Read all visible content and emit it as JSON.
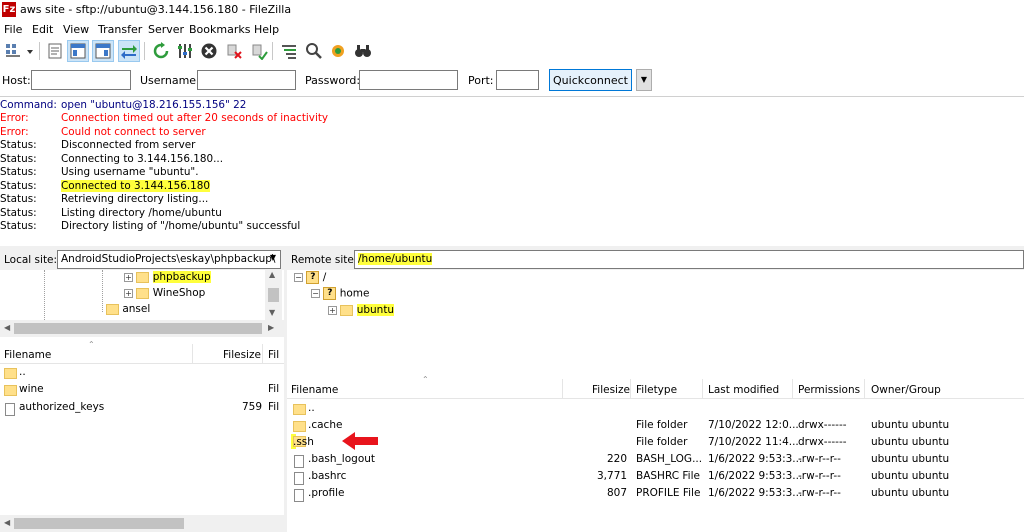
{
  "window": {
    "title": "aws site - sftp://ubuntu@3.144.156.180 - FileZilla",
    "app_icon": "Fz"
  },
  "menu": [
    "File",
    "Edit",
    "View",
    "Transfer",
    "Server",
    "Bookmarks",
    "Help"
  ],
  "toolbar": {
    "icons": [
      "site-manager-icon",
      "dropdown-arrow-icon",
      "message-log-toggle-icon",
      "local-tree-toggle-icon",
      "remote-tree-toggle-icon",
      "transfer-queue-toggle-icon",
      "refresh-icon",
      "process-queue-icon",
      "cancel-icon",
      "disconnect-icon",
      "reconnect-icon",
      "filter-icon",
      "sync-browse-icon",
      "directory-compare-icon",
      "search-icon"
    ]
  },
  "quickconnect": {
    "host_label": "Host:",
    "host_value": "",
    "username_label": "Username:",
    "username_value": "",
    "password_label": "Password:",
    "password_value": "",
    "port_label": "Port:",
    "port_value": "",
    "button_label": "Quickconnect"
  },
  "log": [
    {
      "type": "Command:",
      "msg": "open \"ubuntu@18.216.155.156\" 22",
      "kind": "command"
    },
    {
      "type": "Error:",
      "msg": "Connection timed out after 20 seconds of inactivity",
      "kind": "error"
    },
    {
      "type": "Error:",
      "msg": "Could not connect to server",
      "kind": "error"
    },
    {
      "type": "Status:",
      "msg": "Disconnected from server",
      "kind": "status"
    },
    {
      "type": "Status:",
      "msg": "Connecting to 3.144.156.180...",
      "kind": "status"
    },
    {
      "type": "Status:",
      "msg": "Using username \"ubuntu\".",
      "kind": "status"
    },
    {
      "type": "Status:",
      "msg": "Connected to 3.144.156.180",
      "kind": "status",
      "highlight": true
    },
    {
      "type": "Status:",
      "msg": "Retrieving directory listing...",
      "kind": "status"
    },
    {
      "type": "Status:",
      "msg": "Listing directory /home/ubuntu",
      "kind": "status"
    },
    {
      "type": "Status:",
      "msg": "Directory listing of \"/home/ubuntu\" successful",
      "kind": "status"
    }
  ],
  "local": {
    "site_label": "Local site:",
    "site_path": "AndroidStudioProjects\\eskay\\phpbackup\\",
    "tree": [
      {
        "name": "phpbackup",
        "highlight": true
      },
      {
        "name": "WineShop"
      },
      {
        "name": "ansel"
      }
    ],
    "columns": [
      "Filename",
      "Filesize",
      "Fil"
    ],
    "files": [
      {
        "name": "..",
        "size": "",
        "type": "",
        "icon": "folder"
      },
      {
        "name": "wine",
        "size": "",
        "type": "Fil",
        "icon": "folder"
      },
      {
        "name": "authorized_keys",
        "size": "759",
        "type": "Fil",
        "icon": "file"
      }
    ]
  },
  "remote": {
    "site_label": "Remote site:",
    "site_path": "/home/ubuntu",
    "tree": [
      {
        "name": "/"
      },
      {
        "name": "home"
      },
      {
        "name": "ubuntu",
        "highlight": true
      }
    ],
    "columns": [
      "Filename",
      "Filesize",
      "Filetype",
      "Last modified",
      "Permissions",
      "Owner/Group"
    ],
    "files": [
      {
        "name": "..",
        "size": "",
        "type": "",
        "modified": "",
        "perms": "",
        "owner": "",
        "icon": "folder"
      },
      {
        "name": ".cache",
        "size": "",
        "type": "File folder",
        "modified": "7/10/2022 12:0...",
        "perms": "drwx------",
        "owner": "ubuntu ubuntu",
        "icon": "folder"
      },
      {
        "name": ".ssh",
        "size": "",
        "type": "File folder",
        "modified": "7/10/2022 11:4...",
        "perms": "drwx------",
        "owner": "ubuntu ubuntu",
        "icon": "folder",
        "highlight": true,
        "arrow": true
      },
      {
        "name": ".bash_logout",
        "size": "220",
        "type": "BASH_LOG...",
        "modified": "1/6/2022 9:53:3...",
        "perms": "-rw-r--r--",
        "owner": "ubuntu ubuntu",
        "icon": "file"
      },
      {
        "name": ".bashrc",
        "size": "3,771",
        "type": "BASHRC File",
        "modified": "1/6/2022 9:53:3...",
        "perms": "-rw-r--r--",
        "owner": "ubuntu ubuntu",
        "icon": "file"
      },
      {
        "name": ".profile",
        "size": "807",
        "type": "PROFILE File",
        "modified": "1/6/2022 9:53:3...",
        "perms": "-rw-r--r--",
        "owner": "ubuntu ubuntu",
        "icon": "file"
      }
    ]
  },
  "colors": {
    "highlight": "#ffff3c",
    "error": "#ff0000",
    "command": "#000080",
    "annotation_arrow": "#e8141c"
  }
}
